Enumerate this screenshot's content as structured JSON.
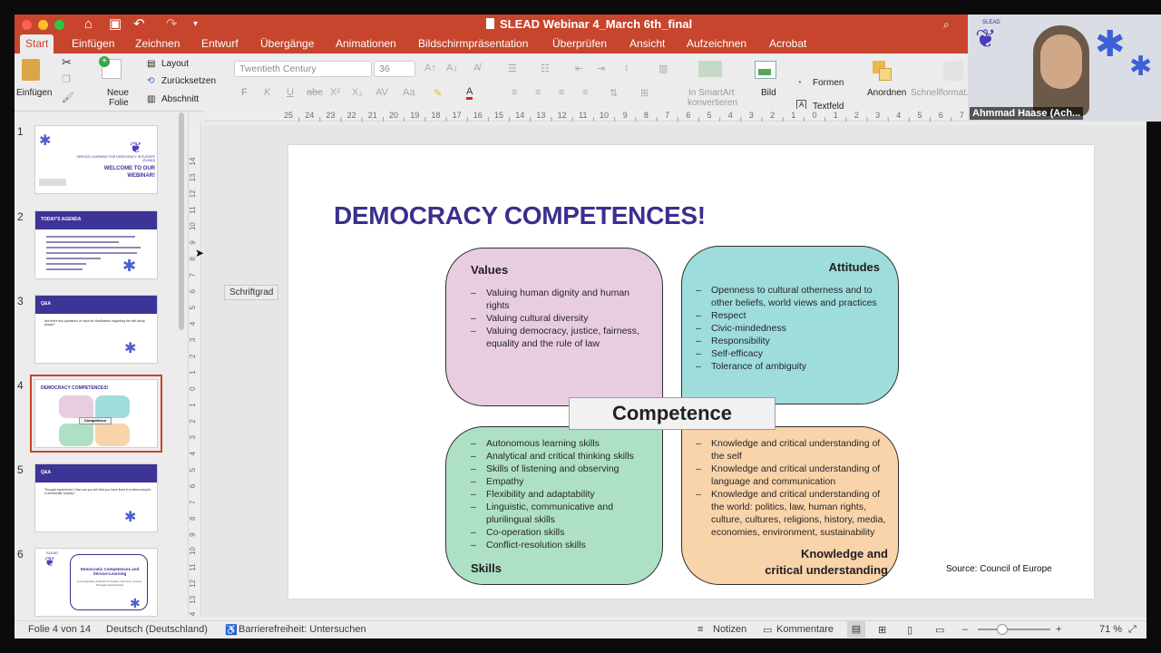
{
  "window": {
    "title": "SLEAD Webinar 4_March 6th_final"
  },
  "tabs": [
    "Start",
    "Einfügen",
    "Zeichnen",
    "Entwurf",
    "Übergänge",
    "Animationen",
    "Bildschirmpräsentation",
    "Überprüfen",
    "Ansicht",
    "Aufzeichnen",
    "Acrobat"
  ],
  "ribbon": {
    "paste_label": "Einfügen",
    "new_slide_line1": "Neue",
    "new_slide_line2": "Folie",
    "layout_label": "Layout",
    "reset_label": "Zurücksetzen",
    "section_label": "Abschnitt",
    "font_name": "Twentieth Century",
    "font_size": "36",
    "smartart_line1": "In SmartArt",
    "smartart_line2": "konvertieren",
    "picture_label": "Bild",
    "shapes_label": "Formen",
    "textbox_label": "Textfeld",
    "arrange_label": "Anordnen",
    "quickstyles_label": "Schnellformat..."
  },
  "thumbnails": [
    {
      "num": "1",
      "lines": [
        "SERVICE-LEARNING FOR DEMOCRACY IN EUROPE (SLEAD)",
        "WELCOME TO OUR",
        "WEBINAR!"
      ]
    },
    {
      "num": "2",
      "header": "TODAY'S AGENDA"
    },
    {
      "num": "3",
      "header": "Q&A",
      "text": "Are there any questions or input for clarification regarding the self-study phase?"
    },
    {
      "num": "4",
      "header": "DEMOCRACY COMPETENCES!",
      "center": "Competence"
    },
    {
      "num": "5",
      "header": "Q&A",
      "text": "Thought experiment: How can you tell that you have lived in a democracy/in a democratic society?"
    },
    {
      "num": "6",
      "lines": [
        "SLEAD",
        "Democratic Competences and Service-Learning",
        "A Comparative Analysis for Austria, Germany, Greece, Portugal and Romania"
      ]
    }
  ],
  "tooltip": "Schriftgrad",
  "slide": {
    "title": "DEMOCRACY COMPETENCES!",
    "center": "Competence",
    "values": {
      "heading": "Values",
      "items": [
        "Valuing human dignity and human rights",
        "Valuing cultural diversity",
        "Valuing democracy, justice, fairness, equality and the rule of law"
      ]
    },
    "attitudes": {
      "heading": "Attitudes",
      "items": [
        "Openness to cultural otherness and to other beliefs, world views and practices",
        "Respect",
        "Civic-mindedness",
        "Responsibility",
        "Self-efficacy",
        "Tolerance of ambiguity"
      ]
    },
    "skills": {
      "heading": "Skills",
      "items": [
        "Autonomous learning skills",
        "Analytical and critical thinking skills",
        "Skills of listening and observing",
        "Empathy",
        "Flexibility and adaptability",
        "Linguistic, communicative and plurilingual skills",
        "Co-operation skills",
        "Conflict-resolution skills"
      ]
    },
    "knowledge": {
      "heading_line1": "Knowledge and",
      "heading_line2": "critical understanding",
      "items": [
        "Knowledge and critical understanding of the self",
        "Knowledge and critical understanding of language and communication",
        "Knowledge and critical understanding of the world: politics, law, human rights, culture, cultures, religions, history, media, economies, environment, sustainability"
      ]
    },
    "source": "Source: Council of Europe"
  },
  "status": {
    "slide_info": "Folie 4 von 14",
    "language": "Deutsch (Deutschland)",
    "accessibility": "Barrierefreiheit: Untersuchen",
    "notes": "Notizen",
    "comments": "Kommentare",
    "zoom": "71 %"
  },
  "webcam": {
    "name": "Ahmmad Haase (Ach...",
    "logo": "SLEAD"
  },
  "colors": {
    "accent": "#c6452c",
    "slide_title": "#3a2f8e",
    "values_fill": "#e8cde0",
    "attitudes_fill": "#9fdcdc",
    "skills_fill": "#aee0c6",
    "knowledge_fill": "#f9d3aa"
  }
}
